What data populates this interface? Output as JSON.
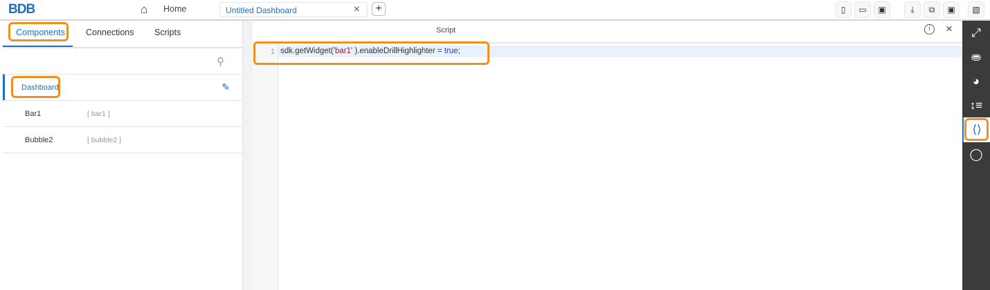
{
  "header": {
    "logo": "BDB",
    "home_label": "Home",
    "tab_title": "Untitled Dashboard",
    "tab_close": "×",
    "add_tab": "+",
    "toolbar_icons": [
      "mobile-icon",
      "tablet-icon",
      "laptop-icon",
      "download-icon",
      "copy-icon",
      "save-icon",
      "preview-monitor-icon"
    ]
  },
  "left_panel": {
    "tabs": [
      {
        "label": "Components"
      },
      {
        "label": "Connections"
      },
      {
        "label": "Scripts"
      }
    ],
    "rows": [
      {
        "name": "Dashboard",
        "id": ""
      },
      {
        "name": "Bar1",
        "id": "[ bar1 ]"
      },
      {
        "name": "Bubble2",
        "id": "[ bubble2 ]"
      }
    ]
  },
  "editor": {
    "title": "Script",
    "info": "i",
    "close": "×",
    "line_number": "1",
    "code": {
      "a": "sdk.getWidget(",
      "b": "'bar1'",
      "c": " ).enableDrillHighlighter = ",
      "d": "true",
      ";": ";"
    }
  },
  "rail": {
    "items": [
      "expand-icon",
      "database-icon",
      "chart-pie-icon",
      "properties-icon",
      "script-icon",
      "lightbulb-icon"
    ]
  },
  "colors": {
    "accent": "#1f6fb8",
    "highlight": "#f0901e",
    "rail": "#3b3b3b"
  }
}
